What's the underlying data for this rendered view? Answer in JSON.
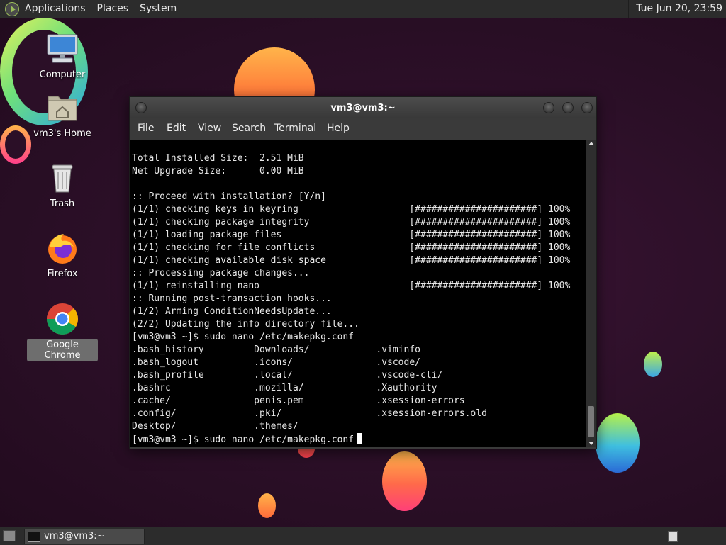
{
  "top_panel": {
    "menus": [
      "Applications",
      "Places",
      "System"
    ],
    "clock": "Tue Jun 20, 23:59"
  },
  "desktop_icons": [
    {
      "label": "Computer",
      "icon": "computer-icon"
    },
    {
      "label": "vm3's Home",
      "icon": "home-folder-icon"
    },
    {
      "label": "Trash",
      "icon": "trash-icon"
    },
    {
      "label": "Firefox",
      "icon": "firefox-icon"
    },
    {
      "label": "Google Chrome",
      "icon": "chrome-icon",
      "selected": true
    }
  ],
  "terminal": {
    "title": "vm3@vm3:~",
    "menu": [
      "File",
      "Edit",
      "View",
      "Search",
      "Terminal",
      "Help"
    ],
    "lines": [
      "Total Installed Size:  2.51 MiB",
      "Net Upgrade Size:      0.00 MiB",
      "",
      ":: Proceed with installation? [Y/n]",
      "(1/1) checking keys in keyring                    [######################] 100%",
      "(1/1) checking package integrity                  [######################] 100%",
      "(1/1) loading package files                       [######################] 100%",
      "(1/1) checking for file conflicts                 [######################] 100%",
      "(1/1) checking available disk space               [######################] 100%",
      ":: Processing package changes...",
      "(1/1) reinstalling nano                           [######################] 100%",
      ":: Running post-transaction hooks...",
      "(1/2) Arming ConditionNeedsUpdate...",
      "(2/2) Updating the info directory file...",
      "[vm3@vm3 ~]$ sudo nano /etc/makepkg.conf",
      ".bash_history         Downloads/            .viminfo",
      ".bash_logout          .icons/               .vscode/",
      ".bash_profile         .local/               .vscode-cli/",
      ".bashrc               .mozilla/             .Xauthority",
      ".cache/               penis.pem             .xsession-errors",
      ".config/              .pki/                 .xsession-errors.old",
      "Desktop/              .themes/"
    ],
    "prompt_line": "[vm3@vm3 ~]$ sudo nano /etc/makepkg.conf"
  },
  "taskbar": {
    "tasks": [
      {
        "label": "vm3@vm3:~"
      }
    ]
  },
  "colors": {
    "panel": "#2c2c2c",
    "terminal_bg": "#000000",
    "terminal_fg": "#e8e8e8",
    "desktop_bg": "#2b0f27"
  }
}
